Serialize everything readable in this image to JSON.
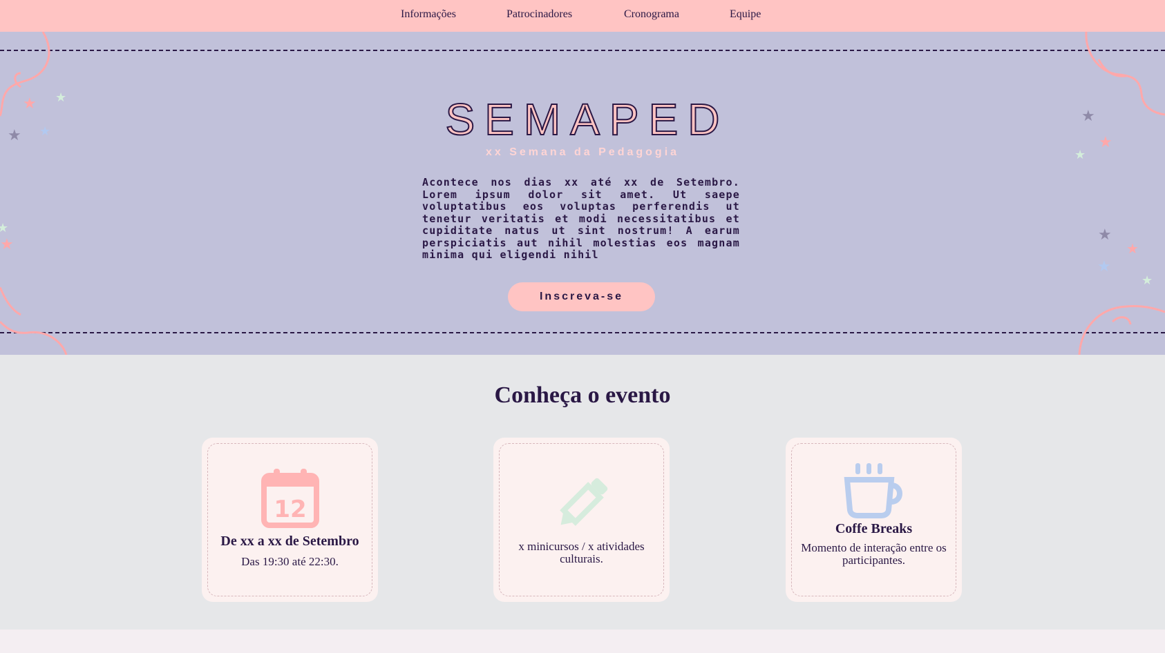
{
  "nav": {
    "items": [
      {
        "label": "Informações"
      },
      {
        "label": "Patrocinadores"
      },
      {
        "label": "Cronograma"
      },
      {
        "label": "Equipe"
      }
    ]
  },
  "hero": {
    "title": "SEMAPED",
    "subtitle": "xx Semana da Pedagogia",
    "description": "Acontece nos dias xx até xx de Setembro. Lorem ipsum dolor sit amet. Ut saepe voluptatibus eos voluptas perferendis ut tenetur veritatis et modi necessitatibus et cupiditate natus ut sint nostrum! A earum perspiciatis aut nihil molestias eos magnam minima qui eligendi nihil",
    "cta_label": "Inscreva-se"
  },
  "about": {
    "title": "Conheça o evento",
    "cards": [
      {
        "icon": "calendar-icon",
        "calendar_day": "12",
        "title": "De xx a xx de Setembro",
        "text": "Das 19:30 até 22:30."
      },
      {
        "icon": "pencil-icon",
        "title": "",
        "text": "x minicursos / x atividades culturais."
      },
      {
        "icon": "coffee-cup-icon",
        "title": "Coffe Breaks",
        "text": "Momento de interação entre os participantes."
      }
    ]
  },
  "colors": {
    "nav_bg": "#ffc4c3",
    "hero_bg": "#c1c1da",
    "primary_text": "#2a1845",
    "accent_pink": "#ffc4c3",
    "section_bg": "#e6e7e9",
    "card_bg": "#fcf1f0",
    "calendar_icon": "#ffb4b4",
    "pencil_icon": "#d6ecdd",
    "cup_icon": "#b9cdee"
  }
}
